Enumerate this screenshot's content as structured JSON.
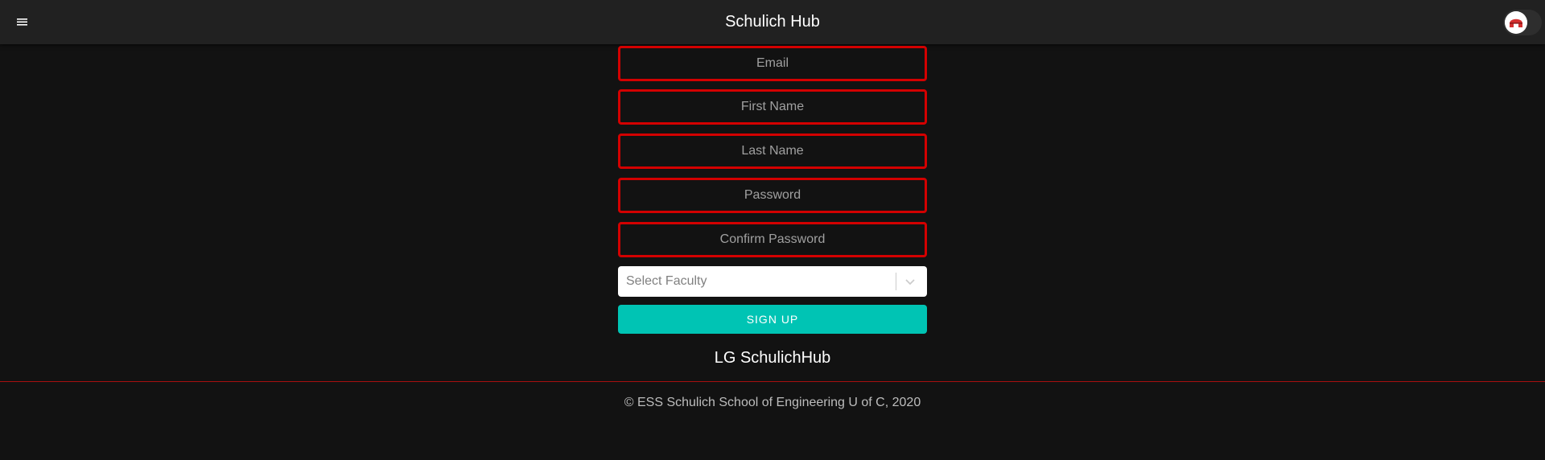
{
  "header": {
    "title": "Schulich Hub",
    "menu_icon": "menu-icon",
    "toggle_icon": "helmet-icon"
  },
  "form": {
    "email_placeholder": "Email",
    "first_name_placeholder": "First Name",
    "last_name_placeholder": "Last Name",
    "password_placeholder": "Password",
    "confirm_password_placeholder": "Confirm Password",
    "faculty_select": {
      "placeholder": "Select Faculty"
    },
    "signup_label": "SIGN UP"
  },
  "brand": "LG SchulichHub",
  "footer": {
    "copyright": "© ESS Schulich School of Engineering U of C, 2020"
  },
  "colors": {
    "topbar": "#212121",
    "background": "#121212",
    "field_border": "#d30000",
    "accent": "#00c4b4",
    "divider": "#a81010"
  }
}
